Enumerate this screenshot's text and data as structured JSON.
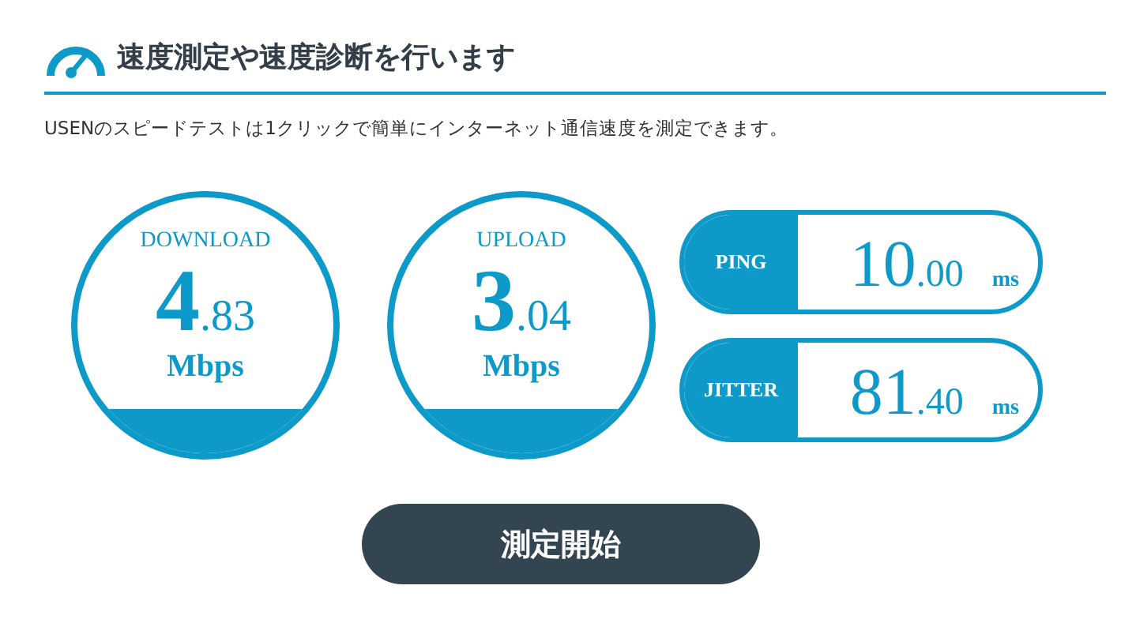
{
  "heading": "速度測定や速度診断を行います",
  "description": "USENのスピードテストは1クリックで簡単にインターネット通信速度を測定できます。",
  "gauges": [
    {
      "label": "DOWNLOAD",
      "integer": "4",
      "decimal": ".83",
      "unit": "Mbps"
    },
    {
      "label": "UPLOAD",
      "integer": "3",
      "decimal": ".04",
      "unit": "Mbps"
    }
  ],
  "metrics": [
    {
      "label": "PING",
      "integer": "10",
      "decimal": ".00",
      "unit": "ms"
    },
    {
      "label": "JITTER",
      "integer": "81",
      "decimal": ".40",
      "unit": "ms"
    }
  ],
  "start_button": "測定開始"
}
